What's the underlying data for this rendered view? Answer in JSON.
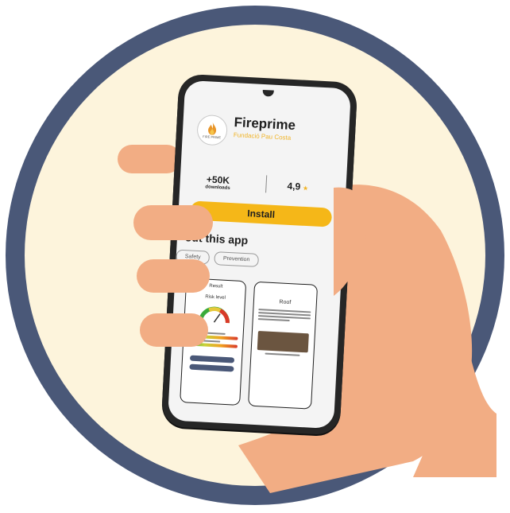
{
  "colors": {
    "ring": "#4a5878",
    "background_disc": "#fdf4dc",
    "skin": "#f2ad84",
    "phone_body": "#262626",
    "accent_yellow": "#f5b718"
  },
  "app": {
    "name": "Fireprime",
    "developer": "Fundació Pau Costa",
    "icon_name": "fireprime-logo-icon",
    "icon_text": "FIRE PRIME"
  },
  "stats": {
    "downloads_value": "+50K",
    "downloads_label": "downloads",
    "rating_value": "4,9",
    "rating_icon": "star-icon"
  },
  "install_label": "Install",
  "about_heading": "About this app",
  "about_heading_visible": "out this app",
  "tags": [
    "Safety",
    "Prevention"
  ],
  "screenshot1": {
    "title": "Result",
    "subtitle": "Risk level"
  },
  "screenshot2": {
    "title": "Roof"
  }
}
